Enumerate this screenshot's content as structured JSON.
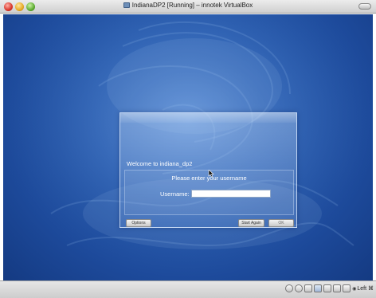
{
  "window": {
    "title": "IndianaDP2 [Running] – innotek VirtualBox"
  },
  "login_dialog": {
    "welcome": "Welcome to indiana_dp2",
    "prompt": "Please enter your username",
    "username_label": "Username:",
    "username_value": "",
    "buttons": {
      "options": "Options",
      "start_again": "Start Again",
      "ok": "OK"
    }
  },
  "statusbar": {
    "icons": [
      "hard-disk-icon",
      "cd-icon",
      "floppy-icon",
      "network-icon",
      "usb-icon",
      "shared-folder-icon",
      "mouse-integration-icon"
    ],
    "host_key": "Left ⌘"
  },
  "colors": {
    "desktop": "#2f64b6",
    "dialog_border": "#e1eeff",
    "text": "#ffffff"
  }
}
